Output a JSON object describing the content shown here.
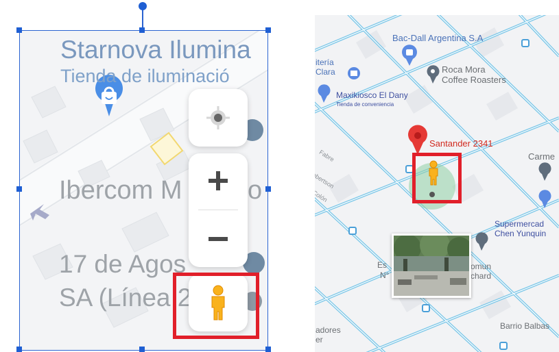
{
  "left_panel": {
    "map_labels": {
      "starnova": "Starnova Ilumina",
      "tienda": "Tienda de iluminació",
      "ibercom": "Ibercom M",
      "ibercom_tail": "o",
      "agosto_line1": "17 de Agos",
      "agosto_line2": "SA (Línea 2"
    },
    "controls": {
      "locate": "crosshair-icon",
      "zoom_in": "plus-icon",
      "zoom_out": "minus-icon",
      "street_view": "pegman-icon"
    },
    "highlight_color": "#e11f2a",
    "selection_color": "#2a63d1"
  },
  "right_panel": {
    "places": {
      "bac_dall": "Bac-Dall Argentina S.A",
      "teria": "itería",
      "clara": "Clara",
      "roca_mora_1": "Roca Mora",
      "roca_mora_2": "Coffee Roasters",
      "maxikiosco": "Maxikiosco El Dany",
      "maxikiosco_sub": "Tienda de conveniencia",
      "santander": "Santander 2341",
      "carme": "Carme",
      "supermercado_1": "Supermercad",
      "supermercado_2": "Chen Yunquin",
      "es": "Es",
      "n": "N°",
      "comun": "omun",
      "chard": "chard",
      "barrio": "Barrio Balbas",
      "adores": "adores",
      "er": "er"
    },
    "streets": {
      "fabre": "Fabre",
      "robertson": "obertson",
      "colon": "Colón"
    },
    "pin_color": "#e53935",
    "street_color": "#7fc8e8",
    "highlight_color": "#e11f2a"
  }
}
